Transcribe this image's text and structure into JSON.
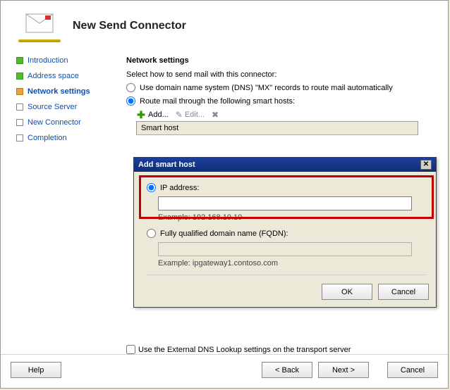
{
  "header": {
    "title": "New Send Connector"
  },
  "sidebar": {
    "items": [
      {
        "label": "Introduction",
        "state": "done"
      },
      {
        "label": "Address space",
        "state": "done"
      },
      {
        "label": "Network settings",
        "state": "current"
      },
      {
        "label": "Source Server",
        "state": "pending"
      },
      {
        "label": "New Connector",
        "state": "pending"
      },
      {
        "label": "Completion",
        "state": "pending"
      }
    ]
  },
  "content": {
    "section_title": "Network settings",
    "select_how_label": "Select how to send mail with this connector:",
    "option_dns": "Use domain name system (DNS) \"MX\" records to route mail automatically",
    "option_smart": "Route mail through the following smart hosts:",
    "toolbar": {
      "add_label": "Add...",
      "edit_label": "Edit..."
    },
    "grid_header": "Smart host",
    "ext_checkbox": "Use the External DNS Lookup settings on the transport server"
  },
  "dialog": {
    "title": "Add smart host",
    "ip_label": "IP address:",
    "ip_value": "",
    "ip_example": "Example: 192.168.10.10",
    "fqdn_label": "Fully qualified domain name (FQDN):",
    "fqdn_value": "",
    "fqdn_example": "Example: ipgateway1.contoso.com",
    "ok_label": "OK",
    "cancel_label": "Cancel"
  },
  "footer": {
    "help_label": "Help",
    "back_label": "< Back",
    "next_label": "Next >",
    "cancel_label": "Cancel"
  }
}
